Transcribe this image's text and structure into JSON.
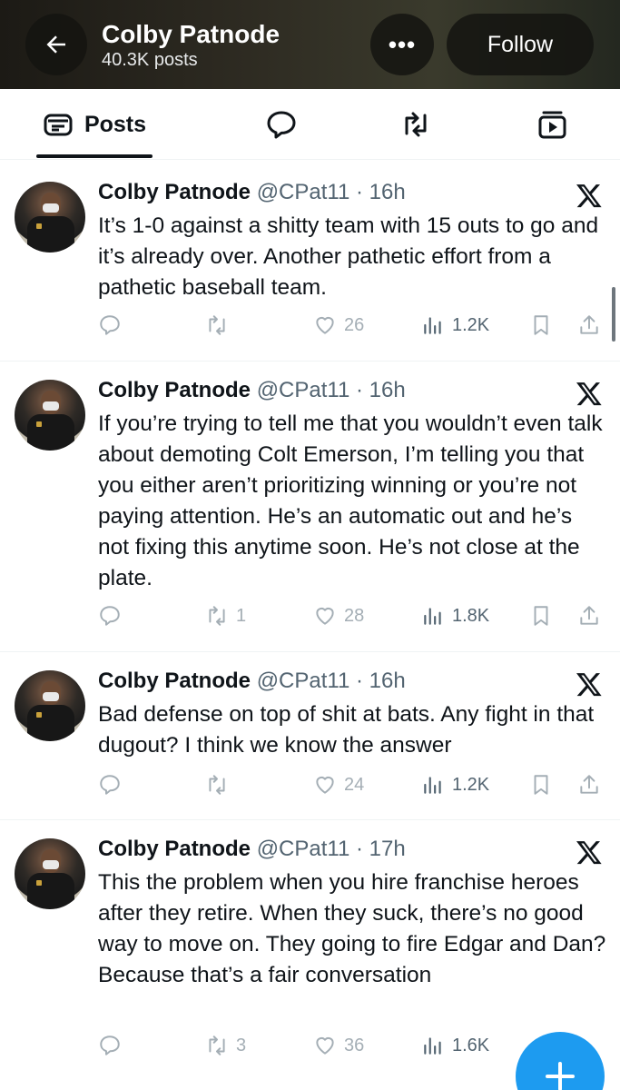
{
  "header": {
    "back_icon": "arrow-left-icon",
    "title": "Colby Patnode",
    "subtitle": "40.3K posts",
    "more_label": "•••",
    "follow_label": "Follow"
  },
  "tabs": [
    {
      "label": "Posts",
      "icon": "posts-icon",
      "active": true
    },
    {
      "label": "",
      "icon": "replies-icon",
      "active": false
    },
    {
      "label": "",
      "icon": "reposts-icon",
      "active": false
    },
    {
      "label": "",
      "icon": "media-icon",
      "active": false
    }
  ],
  "tweets": [
    {
      "name": "Colby Patnode",
      "handle": "@CPat11",
      "time": "16h",
      "text": "It’s 1-0 against a shitty team with 15 outs to go and it’s already over. Another pathetic effort from a pathetic baseball team.",
      "replies": "",
      "reposts": "",
      "likes": "26",
      "views": "1.2K"
    },
    {
      "name": "Colby Patnode",
      "handle": "@CPat11",
      "time": "16h",
      "text": "If you’re trying to tell me that you wouldn’t even talk about demoting Colt Emerson, I’m telling you that you either aren’t prioritizing winning or you’re not paying attention. He’s an automatic out and he’s not fixing this anytime soon. He’s not close at the plate.",
      "replies": "",
      "reposts": "1",
      "likes": "28",
      "views": "1.8K"
    },
    {
      "name": "Colby Patnode",
      "handle": "@CPat11",
      "time": "16h",
      "text": "Bad defense on top of shit at bats. Any fight in that dugout? I think we know the answer",
      "replies": "",
      "reposts": "",
      "likes": "24",
      "views": "1.2K"
    },
    {
      "name": "Colby Patnode",
      "handle": "@CPat11",
      "time": "17h",
      "text": "This the problem when you hire franchise heroes after they retire. When they suck, there’s no good way to move on. They going to fire Edgar and Dan? Because that’s a fair conversation",
      "replies": "",
      "reposts": "3",
      "likes": "36",
      "views": "1.6K"
    }
  ],
  "colors": {
    "accent": "#1d9bf0",
    "text_primary": "#0f1419",
    "text_secondary": "#536471"
  },
  "fab_icon": "compose-plus-icon"
}
